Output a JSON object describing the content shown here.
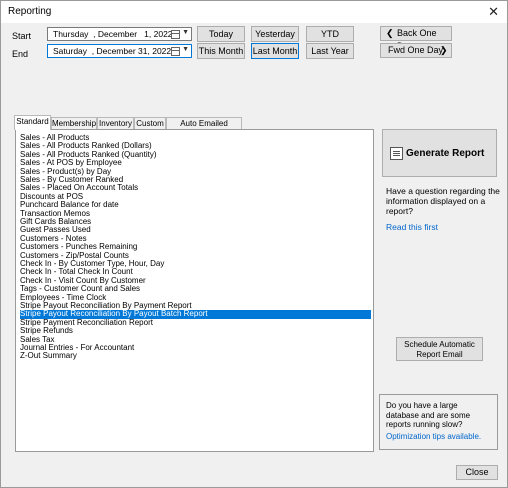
{
  "window": {
    "title": "Reporting",
    "close_glyph": "✕"
  },
  "dates": {
    "start_label": "Start",
    "end_label": "End",
    "start_value": "Thursday  , December   1, 2022",
    "end_value": "Saturday  , December 31, 2022"
  },
  "quick_buttons": {
    "today": "Today",
    "yesterday": "Yesterday",
    "ytd": "YTD",
    "this_month": "This Month",
    "last_month": "Last Month",
    "last_year": "Last Year"
  },
  "nav_buttons": {
    "back": "Back One Day",
    "forward": "Fwd One Day"
  },
  "tabs": [
    "Standard",
    "Membership",
    "Inventory",
    "Custom",
    "Auto Emailed Reports"
  ],
  "selected_tab": "Standard",
  "reports": [
    "Sales - All Products",
    "Sales - All Products Ranked (Dollars)",
    "Sales - All Products Ranked (Quantity)",
    "Sales - At POS by Employee",
    "Sales - Product(s) by Day",
    "Sales - By Customer Ranked",
    "Sales - Placed On Account Totals",
    "Discounts at POS",
    "Punchcard Balance for date",
    "Transaction Memos",
    "Gift Cards Balances",
    "Guest Passes Used",
    "Customers - Notes",
    "Customers - Punches Remaining",
    "Customers - Zip/Postal Counts",
    "Check In - By Customer Type, Hour, Day",
    "Check In - Total Check In Count",
    "Check In - Visit Count By Customer",
    "Tags - Customer Count and Sales",
    "Employees - Time Clock",
    "Stripe Payout Reconciliation By Payment Report",
    "Stripe Payout Reconciliation By Payout Batch Report",
    "Stripe Payment Reconciliation Report",
    "Stripe Refunds",
    "Sales Tax",
    "Journal Entries - For Accountant",
    "Z-Out Summary"
  ],
  "selected_report": "Stripe Payout Reconciliation By Payout Batch Report",
  "generate": {
    "label": "Generate Report",
    "icon": "report-icon"
  },
  "help": {
    "question": "Have a question regarding the information displayed on a report?",
    "link": "Read this first"
  },
  "schedule": {
    "line1": "Schedule Automatic",
    "line2": "Report Email"
  },
  "optimization": {
    "text": "Do you have a large database and are some reports running slow?",
    "link": "Optimization tips available."
  },
  "close_button": "Close",
  "colors": {
    "selection": "#0078d7",
    "link": "#0066cc",
    "focus_border": "#0078d7"
  }
}
